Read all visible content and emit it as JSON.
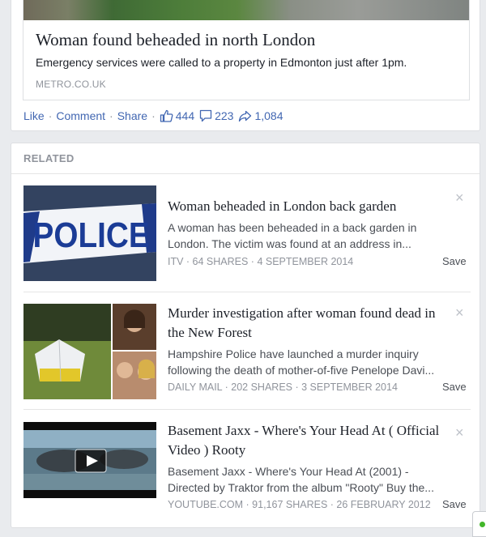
{
  "post": {
    "link_title": "Woman found beheaded in north London",
    "link_description": "Emergency services were called to a property in Edmonton just after 1pm.",
    "link_domain": "METRO.CO.UK",
    "actions": {
      "like": "Like",
      "comment": "Comment",
      "share": "Share",
      "separator": "·",
      "likes_count": "444",
      "comments_count": "223",
      "shares_count": "1,084"
    }
  },
  "related": {
    "header": "RELATED",
    "items": [
      {
        "title": "Woman beheaded in London back garden",
        "description": "A woman has been beheaded in a back garden in London. The victim was found at an address in...",
        "meta": "ITV · 64 SHARES · 4 SEPTEMBER 2014",
        "save": "Save",
        "close": "×",
        "thumb_text": "POLICE"
      },
      {
        "title": "Murder investigation after woman found dead in the New Forest",
        "description": "Hampshire Police have launched a murder inquiry following the death of mother-of-five Penelope Davi...",
        "meta": "DAILY MAIL · 202 SHARES · 3 SEPTEMBER 2014",
        "save": "Save",
        "close": "×"
      },
      {
        "title": "Basement Jaxx - Where's Your Head At ( Official Video ) Rooty",
        "description": "Basement Jaxx - Where's Your Head At (2001) - Directed by Traktor from the album \"Rooty\" Buy the...",
        "meta": "YOUTUBE.COM · 91,167 SHARES · 26 FEBRUARY 2012",
        "save": "Save",
        "close": "×"
      }
    ]
  },
  "icons": {
    "like": "thumbs-up-icon",
    "comment": "comment-bubble-icon",
    "share": "share-arrow-icon",
    "play": "play-icon",
    "chat": "chat-online-icon"
  },
  "colors": {
    "link_blue": "#4267b2",
    "meta_gray": "#90949c",
    "online_green": "#42b72a"
  }
}
